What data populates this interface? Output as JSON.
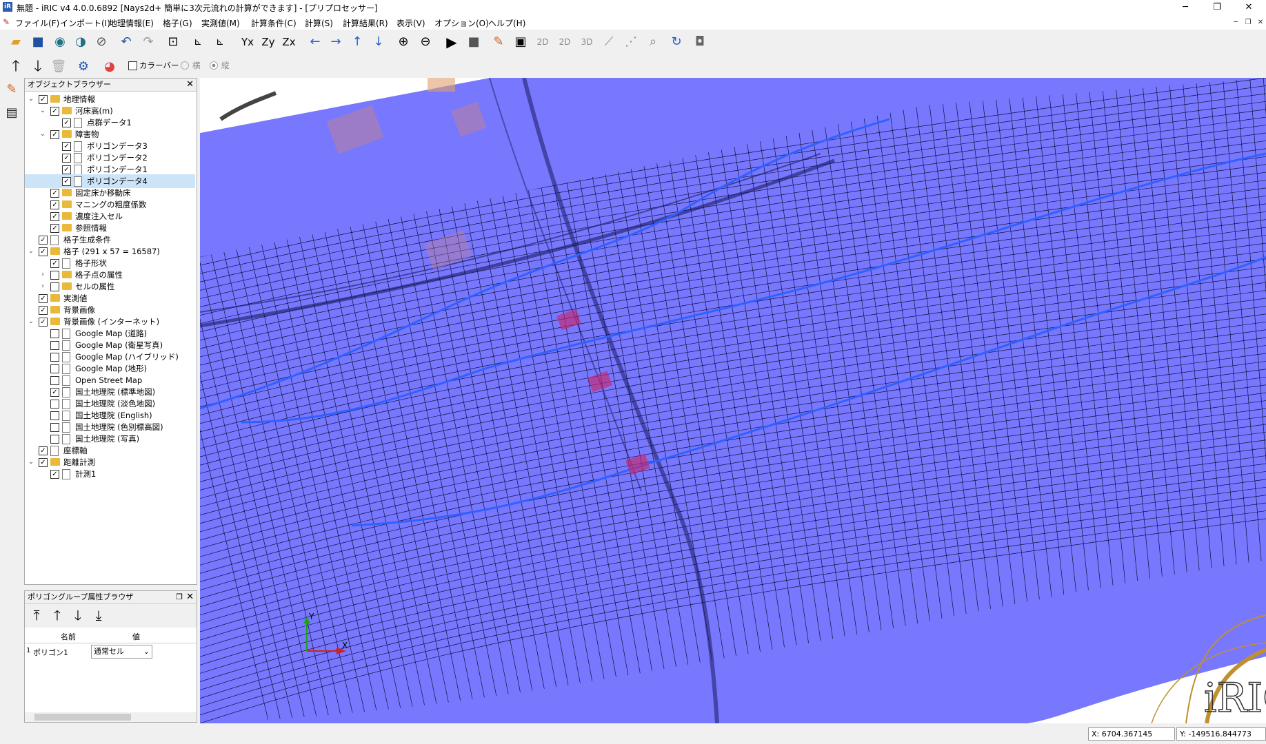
{
  "window": {
    "title": "無題 - iRIC v4 4.0.0.6892 [Nays2d+ 簡単に3次元流れの計算ができます] - [プリプロセッサー]",
    "app_icon": "iR",
    "minimize": "─",
    "maximize": "❐",
    "close": "✕"
  },
  "menu": [
    "ファイル(F)",
    "インポート(I)",
    "地理情報(E)",
    "格子(G)",
    "実測値(M)",
    "計算条件(C)",
    "計算(S)",
    "計算結果(R)",
    "表示(V)",
    "オプション(O)",
    "ヘルプ(H)"
  ],
  "toolbar2": {
    "colorbar_label": "カラーバー",
    "horizontal_label": "横",
    "vertical_label": "縦"
  },
  "object_browser": {
    "title": "オブジェクトブラウザー",
    "items": [
      {
        "label": "地理情報",
        "level": 0,
        "expanded": true,
        "checked": true,
        "icon": "folder"
      },
      {
        "label": "河床高(m)",
        "level": 1,
        "expanded": true,
        "checked": true,
        "icon": "folder"
      },
      {
        "label": "点群データ1",
        "level": 2,
        "checked": true,
        "icon": "doc"
      },
      {
        "label": "障害物",
        "level": 1,
        "expanded": true,
        "checked": true,
        "icon": "folder"
      },
      {
        "label": "ポリゴンデータ3",
        "level": 2,
        "checked": true,
        "icon": "doc"
      },
      {
        "label": "ポリゴンデータ2",
        "level": 2,
        "checked": true,
        "icon": "doc"
      },
      {
        "label": "ポリゴンデータ1",
        "level": 2,
        "checked": true,
        "icon": "doc"
      },
      {
        "label": "ポリゴンデータ4",
        "level": 2,
        "checked": true,
        "icon": "doc",
        "selected": true
      },
      {
        "label": "固定床か移動床",
        "level": 1,
        "checked": true,
        "icon": "folder"
      },
      {
        "label": "マニングの粗度係数",
        "level": 1,
        "checked": true,
        "icon": "folder"
      },
      {
        "label": "濃度注入セル",
        "level": 1,
        "checked": true,
        "icon": "folder"
      },
      {
        "label": "参照情報",
        "level": 1,
        "checked": true,
        "icon": "folder"
      },
      {
        "label": "格子生成条件",
        "level": 0,
        "checked": true,
        "icon": "doc"
      },
      {
        "label": "格子 (291 x 57 = 16587)",
        "level": 0,
        "expanded": true,
        "checked": true,
        "icon": "folder"
      },
      {
        "label": "格子形状",
        "level": 1,
        "checked": true,
        "icon": "doc"
      },
      {
        "label": "格子点の属性",
        "level": 1,
        "collapsed": true,
        "checked": false,
        "icon": "folder"
      },
      {
        "label": "セルの属性",
        "level": 1,
        "collapsed": true,
        "checked": false,
        "icon": "folder"
      },
      {
        "label": "実測値",
        "level": 0,
        "checked": true,
        "icon": "folder"
      },
      {
        "label": "背景画像",
        "level": 0,
        "checked": true,
        "icon": "folder"
      },
      {
        "label": "背景画像 (インターネット)",
        "level": 0,
        "expanded": true,
        "checked": true,
        "icon": "folder"
      },
      {
        "label": "Google Map (道路)",
        "level": 1,
        "checked": false,
        "icon": "doc"
      },
      {
        "label": "Google Map (衛星写真)",
        "level": 1,
        "checked": false,
        "icon": "doc"
      },
      {
        "label": "Google Map (ハイブリッド)",
        "level": 1,
        "checked": false,
        "icon": "doc"
      },
      {
        "label": "Google Map (地形)",
        "level": 1,
        "checked": false,
        "icon": "doc"
      },
      {
        "label": "Open Street Map",
        "level": 1,
        "checked": false,
        "icon": "doc"
      },
      {
        "label": "国土地理院 (標準地図)",
        "level": 1,
        "checked": true,
        "icon": "doc"
      },
      {
        "label": "国土地理院 (淡色地図)",
        "level": 1,
        "checked": false,
        "icon": "doc"
      },
      {
        "label": "国土地理院 (English)",
        "level": 1,
        "checked": false,
        "icon": "doc"
      },
      {
        "label": "国土地理院 (色別標高図)",
        "level": 1,
        "checked": false,
        "icon": "doc"
      },
      {
        "label": "国土地理院 (写真)",
        "level": 1,
        "checked": false,
        "icon": "doc"
      },
      {
        "label": "座標軸",
        "level": 0,
        "checked": true,
        "icon": "doc"
      },
      {
        "label": "距離計測",
        "level": 0,
        "expanded": true,
        "checked": true,
        "icon": "folder"
      },
      {
        "label": "計測1",
        "level": 1,
        "checked": true,
        "icon": "doc"
      }
    ]
  },
  "polygon_browser": {
    "title": "ポリゴングループ属性ブラウザ",
    "col_name": "名前",
    "col_value": "値",
    "rows": [
      {
        "index": "1",
        "name": "ポリゴン1",
        "value": "通常セル"
      }
    ]
  },
  "status": {
    "x": "X: 6704.367145",
    "y": "Y: -149516.844773"
  },
  "canvas": {
    "axis_y": "Y",
    "axis_x": "X",
    "logo": "iRIC"
  },
  "colors": {
    "water": "#7878ff",
    "grid": "#101040",
    "obstacle": "#d02060",
    "stream": "#3060ff",
    "contour": "#c09030"
  }
}
